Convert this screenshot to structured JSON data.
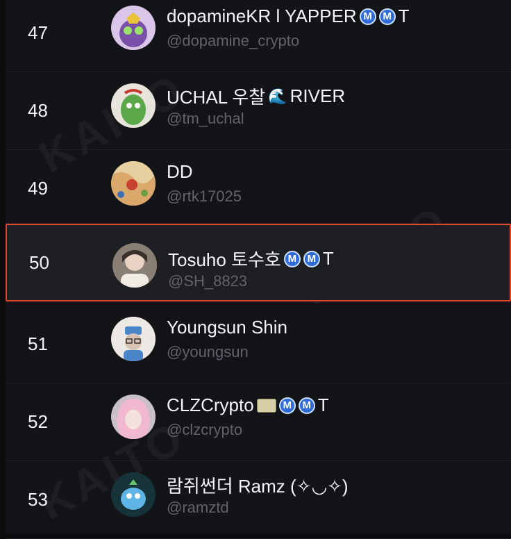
{
  "colors": {
    "background": "#131417",
    "highlight_border": "#e5452f",
    "handle_text": "#5f636b",
    "badge_blue": "#2f6bd9"
  },
  "watermark_text": "KAITO",
  "rows": [
    {
      "rank": "47",
      "name": "dopamineKR l YAPPER",
      "badges": "mmt",
      "handle": "@dopamine_crypto",
      "avatar": "purple-character-avatar"
    },
    {
      "rank": "48",
      "name": "UCHAL 우찰",
      "suffix": "RIVER",
      "emoji": "wave-emoji",
      "handle": "@tm_uchal",
      "avatar": "green-cactus-avatar"
    },
    {
      "rank": "49",
      "name": "DD",
      "handle": "@rtk17025",
      "avatar": "map-pattern-avatar"
    },
    {
      "rank": "50",
      "name": "Tosuho 토수호",
      "badges": "mmt",
      "handle": "@SH_8823",
      "avatar": "portrait-avatar",
      "highlighted": true
    },
    {
      "rank": "51",
      "name": "Youngsun Shin",
      "handle": "@youngsun",
      "avatar": "cartoon-glasses-avatar"
    },
    {
      "rank": "52",
      "name": "CLZCrypto",
      "emoji": "money-emoji",
      "badges": "mmt",
      "handle": "@clzcrypto",
      "avatar": "anime-pink-hair-avatar"
    },
    {
      "rank": "53",
      "name": "람쥐썬더 Ramz (✧◡✧)",
      "handle": "@ramztd",
      "avatar": "blue-creature-avatar"
    }
  ],
  "badge_letter": "M",
  "badge_suffix": "T"
}
